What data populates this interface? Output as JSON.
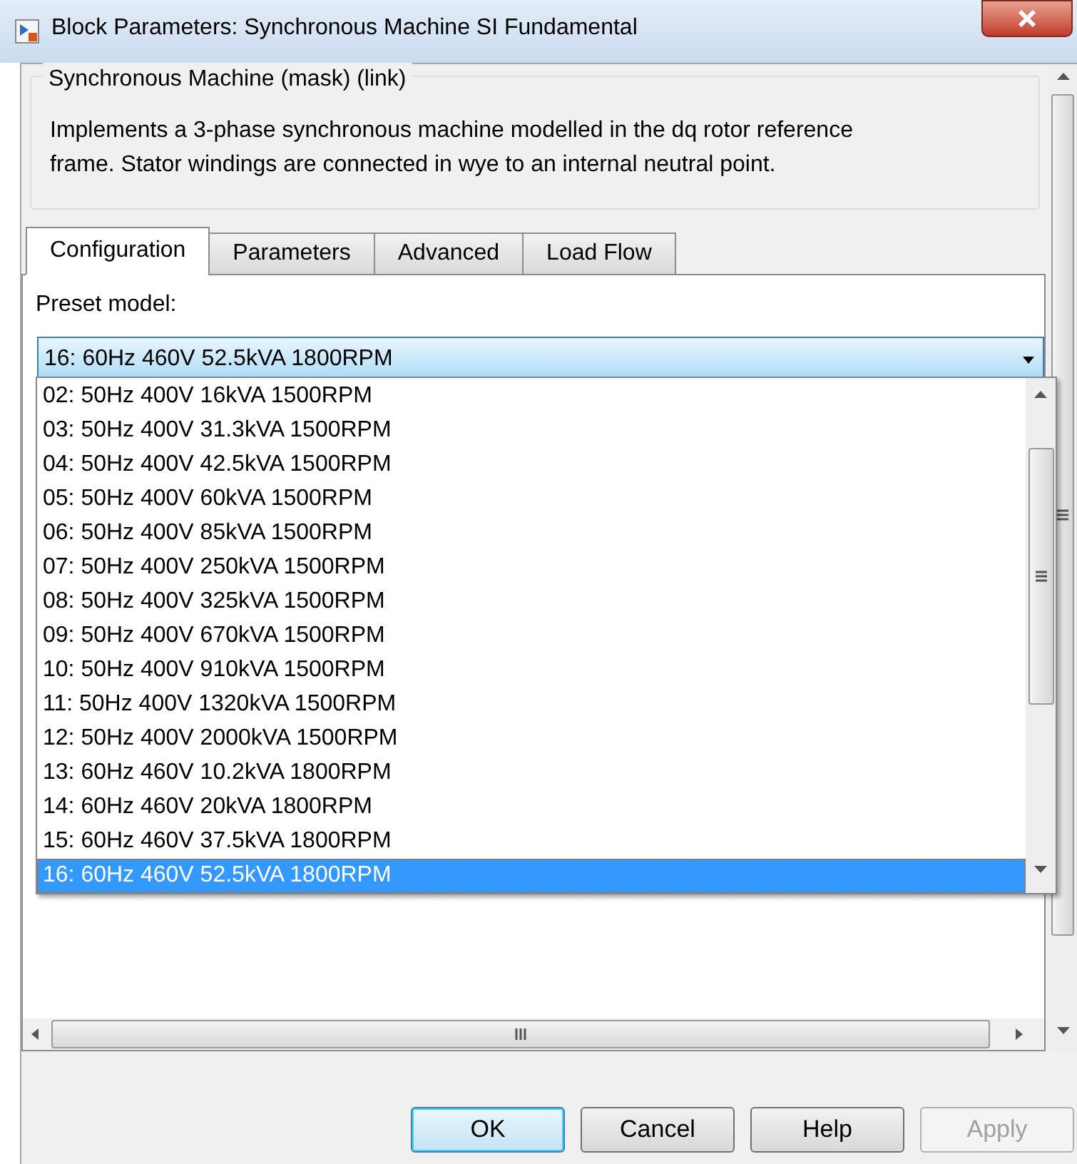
{
  "window": {
    "title": "Block Parameters: Synchronous Machine SI Fundamental"
  },
  "group": {
    "title": "Synchronous Machine (mask) (link)",
    "description": "Implements a 3-phase synchronous machine modelled in the dq rotor reference frame. Stator windings are connected in wye to an internal neutral point."
  },
  "tabs": [
    {
      "label": "Configuration",
      "selected": true
    },
    {
      "label": "Parameters",
      "selected": false
    },
    {
      "label": "Advanced",
      "selected": false
    },
    {
      "label": "Load Flow",
      "selected": false
    }
  ],
  "preset_model": {
    "label": "Preset  model:",
    "value": "16: 60Hz 460V 52.5kVA 1800RPM",
    "expanded": true
  },
  "dropdown_options": [
    {
      "label": "02: 50Hz 400V 16kVA 1500RPM",
      "selected": false
    },
    {
      "label": "03: 50Hz 400V 31.3kVA 1500RPM",
      "selected": false
    },
    {
      "label": "04: 50Hz 400V 42.5kVA 1500RPM",
      "selected": false
    },
    {
      "label": "05: 50Hz 400V 60kVA 1500RPM",
      "selected": false
    },
    {
      "label": "06: 50Hz 400V 85kVA 1500RPM",
      "selected": false
    },
    {
      "label": "07: 50Hz 400V 250kVA 1500RPM",
      "selected": false
    },
    {
      "label": "08: 50Hz 400V 325kVA 1500RPM",
      "selected": false
    },
    {
      "label": "09: 50Hz 400V 670kVA 1500RPM",
      "selected": false
    },
    {
      "label": "10: 50Hz 400V 910kVA 1500RPM",
      "selected": false
    },
    {
      "label": "11: 50Hz 400V 1320kVA 1500RPM",
      "selected": false
    },
    {
      "label": "12: 50Hz 400V 2000kVA 1500RPM",
      "selected": false
    },
    {
      "label": "13: 60Hz 460V 10.2kVA 1800RPM",
      "selected": false
    },
    {
      "label": "14: 60Hz 460V 20kVA 1800RPM",
      "selected": false
    },
    {
      "label": "15: 60Hz 460V 37.5kVA 1800RPM",
      "selected": false
    },
    {
      "label": "16: 60Hz 460V 52.5kVA 1800RPM",
      "selected": true
    }
  ],
  "buttons": [
    {
      "label": "OK",
      "disabled": false,
      "focused": true
    },
    {
      "label": "Cancel",
      "disabled": false,
      "focused": false
    },
    {
      "label": "Help",
      "disabled": false,
      "focused": false
    },
    {
      "label": "Apply",
      "disabled": true,
      "focused": false
    }
  ]
}
